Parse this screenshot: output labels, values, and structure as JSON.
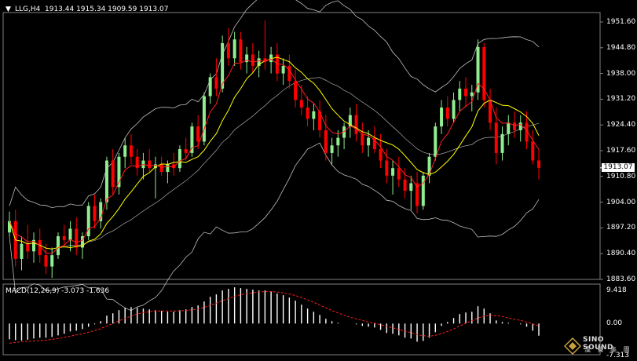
{
  "main_header": {
    "symbol": "LLG,H4",
    "ohlc": "1913.44 1915.34 1909.59 1913.07"
  },
  "price_axis": {
    "ticks": [
      "1951.60",
      "1944.80",
      "1938.00",
      "1931.20",
      "1924.40",
      "1917.60",
      "1910.80",
      "1904.00",
      "1897.20",
      "1890.40",
      "1883.60"
    ],
    "current_price": "1913.07"
  },
  "macd_header": {
    "label": "MACD(12,26,9) -3.073 -1.636"
  },
  "macd_axis": {
    "ticks": [
      "9.418",
      "0.00",
      "-7.313"
    ]
  },
  "logo": {
    "line1": "SINO SOUND",
    "line2": "漢 聲 集 團"
  },
  "colors": {
    "bull": "#90EE90",
    "bear": "#FF0000",
    "ma": "#FFFF00",
    "ema": "#FF2020",
    "bands": "#C0C0C0",
    "macd_hist": "#FFFFFF",
    "signal": "#FF2020"
  },
  "chart_data": {
    "type": "candlestick",
    "price_range": [
      1883.6,
      1958.4
    ],
    "candles": [
      [
        1896.0,
        1901.5,
        1895.0,
        1899.0
      ],
      [
        1899.0,
        1902.0,
        1887.0,
        1889.0
      ],
      [
        1889.0,
        1895.0,
        1886.0,
        1893.0
      ],
      [
        1893.0,
        1898.0,
        1889.0,
        1891.0
      ],
      [
        1891.0,
        1896.0,
        1888.0,
        1894.0
      ],
      [
        1894.0,
        1897.0,
        1888.0,
        1890.0
      ],
      [
        1890.0,
        1893.0,
        1885.0,
        1887.0
      ],
      [
        1887.0,
        1892.0,
        1884.0,
        1890.0
      ],
      [
        1890.0,
        1896.0,
        1889.0,
        1895.0
      ],
      [
        1895.0,
        1898.0,
        1892.0,
        1894.0
      ],
      [
        1894.0,
        1899.0,
        1891.0,
        1897.0
      ],
      [
        1897.0,
        1900.0,
        1890.0,
        1892.0
      ],
      [
        1892.0,
        1896.0,
        1889.0,
        1895.0
      ],
      [
        1895.0,
        1904.0,
        1894.0,
        1903.0
      ],
      [
        1903.0,
        1906.0,
        1897.0,
        1899.0
      ],
      [
        1899.0,
        1905.0,
        1897.0,
        1904.0
      ],
      [
        1904.0,
        1916.0,
        1902.0,
        1915.0
      ],
      [
        1915.0,
        1918.0,
        1906.0,
        1908.0
      ],
      [
        1908.0,
        1917.0,
        1906.0,
        1916.0
      ],
      [
        1916.0,
        1921.0,
        1913.0,
        1919.0
      ],
      [
        1919.0,
        1922.0,
        1914.0,
        1916.0
      ],
      [
        1916.0,
        1918.0,
        1911.0,
        1913.0
      ],
      [
        1913.0,
        1917.0,
        1910.0,
        1915.0
      ],
      [
        1915.0,
        1918.0,
        1912.0,
        1913.0
      ],
      [
        1913.0,
        1916.0,
        1905.0,
        1914.0
      ],
      [
        1914.0,
        1916.0,
        1911.0,
        1912.0
      ],
      [
        1912.0,
        1915.0,
        1909.0,
        1914.0
      ],
      [
        1914.0,
        1917.0,
        1911.0,
        1913.0
      ],
      [
        1913.0,
        1919.0,
        1912.0,
        1918.0
      ],
      [
        1918.0,
        1921.0,
        1915.0,
        1917.0
      ],
      [
        1917.0,
        1925.0,
        1916.0,
        1924.0
      ],
      [
        1924.0,
        1927.0,
        1918.0,
        1920.0
      ],
      [
        1920.0,
        1933.0,
        1919.0,
        1932.0
      ],
      [
        1932.0,
        1938.0,
        1930.0,
        1937.0
      ],
      [
        1937.0,
        1942.0,
        1932.0,
        1934.0
      ],
      [
        1934.0,
        1948.0,
        1933.0,
        1946.0
      ],
      [
        1946.0,
        1950.0,
        1940.0,
        1942.0
      ],
      [
        1942.0,
        1949.0,
        1940.0,
        1947.0
      ],
      [
        1947.0,
        1949.0,
        1939.0,
        1941.0
      ],
      [
        1941.0,
        1945.0,
        1938.0,
        1943.0
      ],
      [
        1943.0,
        1946.0,
        1938.0,
        1940.0
      ],
      [
        1940.0,
        1944.0,
        1937.0,
        1942.0
      ],
      [
        1942.0,
        1952.0,
        1939.0,
        1941.0
      ],
      [
        1941.0,
        1945.0,
        1938.0,
        1943.0
      ],
      [
        1943.0,
        1946.0,
        1936.0,
        1938.0
      ],
      [
        1938.0,
        1942.0,
        1935.0,
        1940.0
      ],
      [
        1940.0,
        1943.0,
        1934.0,
        1936.0
      ],
      [
        1936.0,
        1939.0,
        1929.0,
        1931.0
      ],
      [
        1931.0,
        1935.0,
        1927.0,
        1929.0
      ],
      [
        1929.0,
        1932.0,
        1924.0,
        1926.0
      ],
      [
        1926.0,
        1930.0,
        1923.0,
        1928.0
      ],
      [
        1928.0,
        1931.0,
        1921.0,
        1923.0
      ],
      [
        1923.0,
        1927.0,
        1915.0,
        1917.0
      ],
      [
        1917.0,
        1921.0,
        1914.0,
        1919.0
      ],
      [
        1919.0,
        1923.0,
        1916.0,
        1921.0
      ],
      [
        1921.0,
        1925.0,
        1918.0,
        1924.0
      ],
      [
        1924.0,
        1929.0,
        1921.0,
        1927.0
      ],
      [
        1927.0,
        1930.0,
        1920.0,
        1922.0
      ],
      [
        1922.0,
        1925.0,
        1917.0,
        1919.0
      ],
      [
        1919.0,
        1923.0,
        1916.0,
        1921.0
      ],
      [
        1921.0,
        1924.0,
        1917.0,
        1918.0
      ],
      [
        1918.0,
        1922.0,
        1913.0,
        1915.0
      ],
      [
        1915.0,
        1918.0,
        1909.0,
        1911.0
      ],
      [
        1911.0,
        1915.0,
        1906.0,
        1913.0
      ],
      [
        1913.0,
        1916.0,
        1908.0,
        1910.0
      ],
      [
        1910.0,
        1913.0,
        1905.0,
        1907.0
      ],
      [
        1907.0,
        1911.0,
        1902.0,
        1909.0
      ],
      [
        1909.0,
        1912.0,
        1901.0,
        1903.0
      ],
      [
        1903.0,
        1912.0,
        1902.0,
        1911.0
      ],
      [
        1911.0,
        1917.0,
        1909.0,
        1916.0
      ],
      [
        1916.0,
        1925.0,
        1915.0,
        1924.0
      ],
      [
        1924.0,
        1931.0,
        1922.0,
        1929.0
      ],
      [
        1929.0,
        1932.0,
        1924.0,
        1926.0
      ],
      [
        1926.0,
        1933.0,
        1925.0,
        1931.0
      ],
      [
        1931.0,
        1936.0,
        1928.0,
        1934.0
      ],
      [
        1934.0,
        1937.0,
        1929.0,
        1932.0
      ],
      [
        1932.0,
        1935.0,
        1928.0,
        1933.0
      ],
      [
        1933.0,
        1947.0,
        1931.0,
        1945.0
      ],
      [
        1945.0,
        1946.0,
        1929.0,
        1931.0
      ],
      [
        1931.0,
        1934.0,
        1923.0,
        1925.0
      ],
      [
        1925.0,
        1929.0,
        1914.0,
        1917.0
      ],
      [
        1917.0,
        1924.0,
        1915.0,
        1922.0
      ],
      [
        1922.0,
        1927.0,
        1919.0,
        1925.0
      ],
      [
        1925.0,
        1928.0,
        1921.0,
        1923.0
      ],
      [
        1923.0,
        1927.0,
        1920.0,
        1925.0
      ],
      [
        1925.0,
        1928.0,
        1918.0,
        1920.0
      ],
      [
        1920.0,
        1923.0,
        1914.0,
        1915.0
      ],
      [
        1915.0,
        1918.0,
        1910.0,
        1913.07
      ]
    ],
    "macd_range": [
      -7.313,
      9.418
    ],
    "macd": [
      -4,
      -4.2,
      -4.3,
      -4.1,
      -3.8,
      -3.6,
      -3.6,
      -3.4,
      -3.0,
      -2.6,
      -2.0,
      -1.8,
      -1.4,
      -0.8,
      -0.2,
      0.6,
      2.0,
      2.6,
      3.4,
      4.0,
      4.2,
      4.0,
      3.8,
      3.6,
      3.4,
      3.2,
      3.0,
      3.0,
      3.4,
      3.6,
      4.2,
      4.6,
      5.6,
      6.8,
      7.4,
      8.4,
      8.8,
      9.2,
      9.0,
      8.8,
      8.6,
      8.4,
      8.4,
      8.2,
      7.6,
      7.2,
      6.6,
      5.8,
      4.8,
      3.8,
      3.0,
      2.2,
      1.2,
      0.6,
      0.2,
      0,
      0,
      -0.2,
      -0.6,
      -0.8,
      -1.0,
      -1.6,
      -2.4,
      -2.6,
      -3.0,
      -3.6,
      -3.8,
      -4.6,
      -4.4,
      -3.6,
      -2.2,
      -0.6,
      0.4,
      1.4,
      2.4,
      2.8,
      3.0,
      4.4,
      3.8,
      2.6,
      0.8,
      0.4,
      0.2,
      0,
      -0.2,
      -0.8,
      -1.8,
      -3.07
    ],
    "signal": [
      -5,
      -4.8,
      -4.6,
      -4.5,
      -4.4,
      -4.3,
      -4.2,
      -4.0,
      -3.8,
      -3.5,
      -3.2,
      -2.9,
      -2.6,
      -2.2,
      -1.8,
      -1.3,
      -0.6,
      0.0,
      0.7,
      1.3,
      1.9,
      2.4,
      2.8,
      3.0,
      3.2,
      3.2,
      3.2,
      3.2,
      3.2,
      3.3,
      3.5,
      3.7,
      4.1,
      4.6,
      5.2,
      5.8,
      6.4,
      6.9,
      7.3,
      7.6,
      7.8,
      8.0,
      8.1,
      8.1,
      8.0,
      7.8,
      7.5,
      7.1,
      6.6,
      6.0,
      5.4,
      4.7,
      4.0,
      3.3,
      2.7,
      2.1,
      1.6,
      1.2,
      0.8,
      0.4,
      0.1,
      -0.3,
      -0.7,
      -1.1,
      -1.5,
      -1.9,
      -2.3,
      -2.8,
      -3.1,
      -3.2,
      -3.0,
      -2.6,
      -2.0,
      -1.4,
      -0.6,
      0.1,
      0.7,
      1.4,
      1.9,
      2.1,
      2.0,
      1.8,
      1.4,
      1.1,
      0.8,
      0.4,
      -0.1,
      -0.6
    ]
  }
}
